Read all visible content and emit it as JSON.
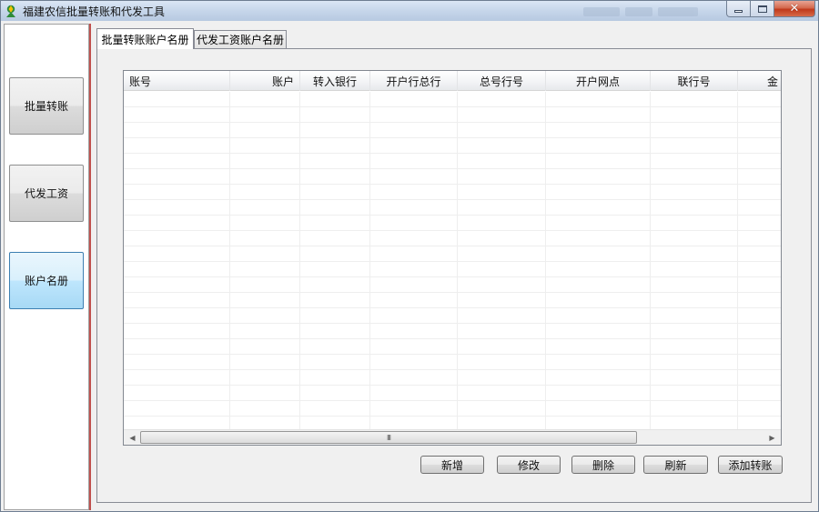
{
  "window": {
    "title": "福建农信批量转账和代发工具",
    "controls": {
      "minimize_icon": "minimize-icon",
      "maximize_icon": "maximize-icon",
      "close_icon": "close-icon"
    }
  },
  "sidebar": {
    "items": [
      {
        "label": "批量转账",
        "active": false
      },
      {
        "label": "代发工资",
        "active": false
      },
      {
        "label": "账户名册",
        "active": true
      }
    ]
  },
  "tabs": [
    {
      "label": "批量转账账户名册",
      "active": true
    },
    {
      "label": "代发工资账户名册",
      "active": false
    }
  ],
  "grid": {
    "columns": [
      "账号",
      "账户",
      "转入银行",
      "开户行总行",
      "总号行号",
      "开户网点",
      "联行号",
      "金"
    ],
    "rows": []
  },
  "scrollbar": {
    "thumb_grip": "III"
  },
  "actions": {
    "add": "新增",
    "edit": "修改",
    "delete": "删除",
    "refresh": "刷新",
    "add_transfer": "添加转账"
  },
  "colors": {
    "accent_red": "#c0504d",
    "active_button": "#bee6fd",
    "titlebar": "#c6d6ea"
  }
}
